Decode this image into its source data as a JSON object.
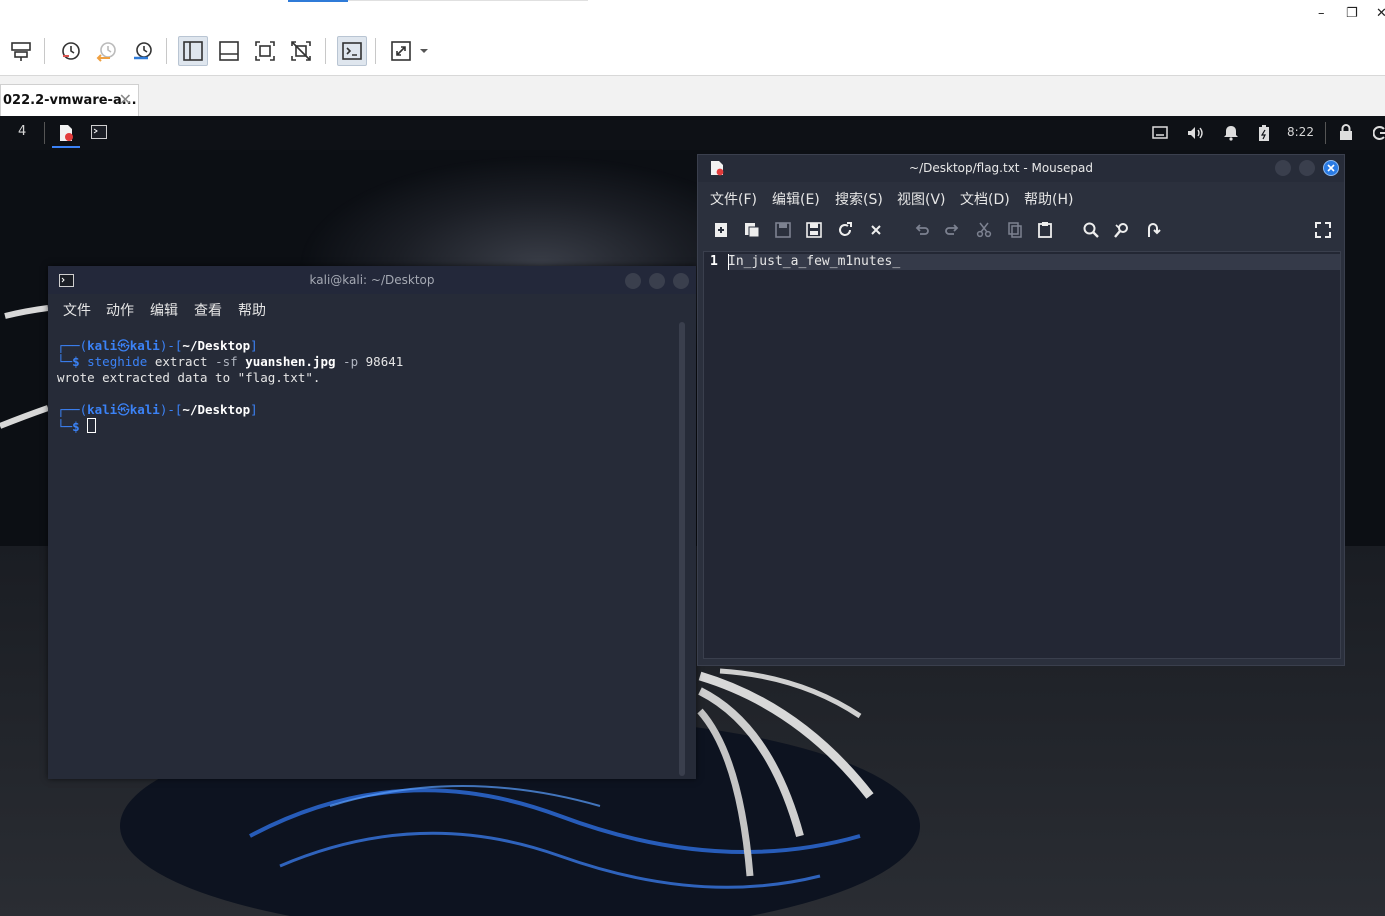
{
  "host": {
    "window_controls": {
      "minimize": "–",
      "restore": "❐",
      "close": "✕"
    },
    "toolbar": {
      "icons": [
        "send-keys-icon",
        "snapshot-icon",
        "revert-snapshot-icon",
        "snapshot-manager-icon",
        "library-icon",
        "console-view-icon",
        "fullscreen-icon",
        "unity-icon",
        "terminal-icon",
        "stretch-icon",
        "dropdown-icon"
      ]
    },
    "vm_tab": {
      "label": "022.2-vmware-a...",
      "close": "✕"
    }
  },
  "guest": {
    "panel": {
      "workspace": "4",
      "clock": "8:22"
    },
    "terminal": {
      "title": "kali@kali: ~/Desktop",
      "menu": [
        "文件",
        "动作",
        "编辑",
        "查看",
        "帮助"
      ],
      "lines": {
        "p1_open": "┌──(",
        "user": "kali",
        "at": "㉿",
        "host": "kali",
        "p1_mid": ")-[",
        "path": "~/Desktop",
        "p1_close": "]",
        "p2_prefix": "└─",
        "dollar": "$",
        "cmd": "steghide",
        "arg1": "extract",
        "arg2": "-sf",
        "file": "yuanshen.jpg",
        "arg3": "-p",
        "arg4": "98641",
        "output": "wrote extracted data to \"flag.txt\"."
      }
    },
    "mousepad": {
      "title": "~/Desktop/flag.txt - Mousepad",
      "menu": [
        "文件(F)",
        "编辑(E)",
        "搜索(S)",
        "视图(V)",
        "文档(D)",
        "帮助(H)"
      ],
      "line_number": "1",
      "content": "In_just_a_few_m1nutes_"
    }
  }
}
